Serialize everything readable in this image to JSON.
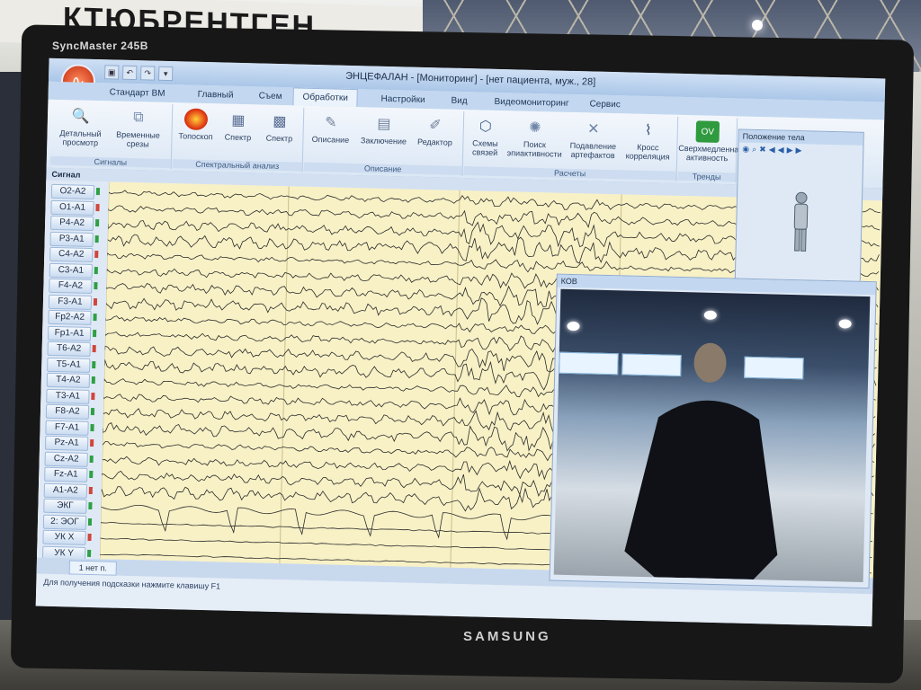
{
  "environment": {
    "banner_text": "КТЮБРЕНТГЕН",
    "monitor_model": "SyncMaster 245B",
    "monitor_brand": "SAMSUNG"
  },
  "app": {
    "window_title": "ЭНЦЕФАЛАН - [Мониторинг] - [нет пациента, муж., 28]",
    "quick_access": [
      "save",
      "undo",
      "redo",
      "more"
    ]
  },
  "ribbon": {
    "tabs": [
      "Стандарт ВМ",
      "Главный",
      "Съем",
      "Обработки",
      "Настройки",
      "Вид",
      "Видеомониторинг",
      "Сервис"
    ],
    "active_tab": "Обработки",
    "groups": [
      {
        "label": "Сигналы",
        "tools": [
          "Детальный просмотр",
          "Временные срезы"
        ]
      },
      {
        "label": "Спектральный анализ",
        "tools": [
          "Топоскоп",
          "Спектр",
          "Спектр"
        ]
      },
      {
        "label": "Описание",
        "tools": [
          "Описание",
          "Заключение",
          "Редактор"
        ]
      },
      {
        "label": "Расчеты",
        "tools": [
          "Схемы связей",
          "Поиск эпиактивности",
          "Подавление артефактов",
          "Кросс корреляция"
        ]
      },
      {
        "label": "Тренды",
        "tools": [
          "Сверхмедленная активность"
        ]
      }
    ]
  },
  "signal_header": "Сигнал",
  "channels": [
    "O2-A2",
    "O1-A1",
    "P4-A2",
    "P3-A1",
    "C4-A2",
    "C3-A1",
    "F4-A2",
    "F3-A1",
    "Fp2-A2",
    "Fp1-A1",
    "T6-A2",
    "T5-A1",
    "T4-A2",
    "T3-A1",
    "F8-A2",
    "F7-A1",
    "Pz-A1",
    "Cz-A2",
    "Fz-A1",
    "A1-A2",
    "ЭКГ",
    "2: ЭОГ",
    "УК X",
    "УК Y"
  ],
  "colors": {
    "trace_bg": "#f8f1c6",
    "marker_green": "#2ea043",
    "marker_red": "#d1453b"
  },
  "position_panel": {
    "title": "Положение тела"
  },
  "video_panel": {
    "title": "КОВ"
  },
  "bottom_tab": "1 нет п.",
  "status_text": "Для получения подсказки нажмите клавишу F1"
}
